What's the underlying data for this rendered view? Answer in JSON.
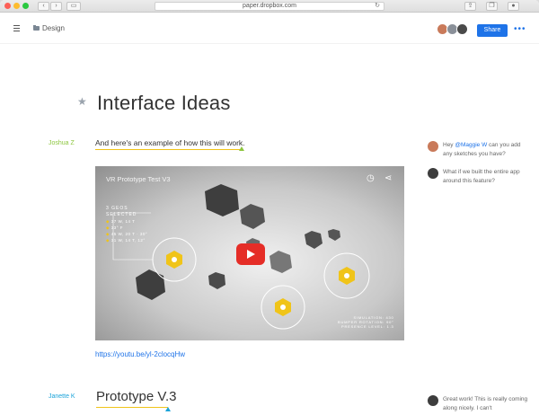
{
  "browser": {
    "url": "paper.dropbox.com",
    "back_icon": "chevron-left-icon",
    "forward_icon": "chevron-right-icon",
    "reload_icon": "reload-icon"
  },
  "header": {
    "breadcrumb": "Design",
    "share_label": "Share",
    "more_label": "•••"
  },
  "doc": {
    "title": "Interface Ideas",
    "author1": "Joshua Z",
    "line1": "And here's an example of how this will work.",
    "video": {
      "title": "VR Prototype Test V3",
      "stats_head": "3 GEOS",
      "stats_sub": "SELECTED",
      "stats_rows": [
        "37 W, 14 T",
        "33° F",
        "45 W, 20 T · 30°",
        "31 W, 14 T, 12°"
      ],
      "caption": [
        "SIMULATION: 430",
        "BUMPER ROTATION: 90°",
        "PRESENCE LEVEL: 1.3"
      ]
    },
    "link": "https://youtu.be/yl-2clocqHw",
    "author2": "Janette K",
    "heading2": "Prototype V.3"
  },
  "comments": [
    {
      "pre": "Hey ",
      "mention": "@Maggie W",
      "post": " can you add any sketches you have?"
    },
    {
      "pre": "What if we built the entire app around this feature?",
      "mention": "",
      "post": ""
    },
    {
      "pre": "Great work! This is really coming along nicely. I can't",
      "mention": "",
      "post": ""
    }
  ],
  "colors": {
    "accent": "#1e73e8",
    "green_author": "#8dc63f",
    "blue_author": "#1aa3d9",
    "highlight": "#f0c419",
    "youtube": "#e52d27"
  }
}
